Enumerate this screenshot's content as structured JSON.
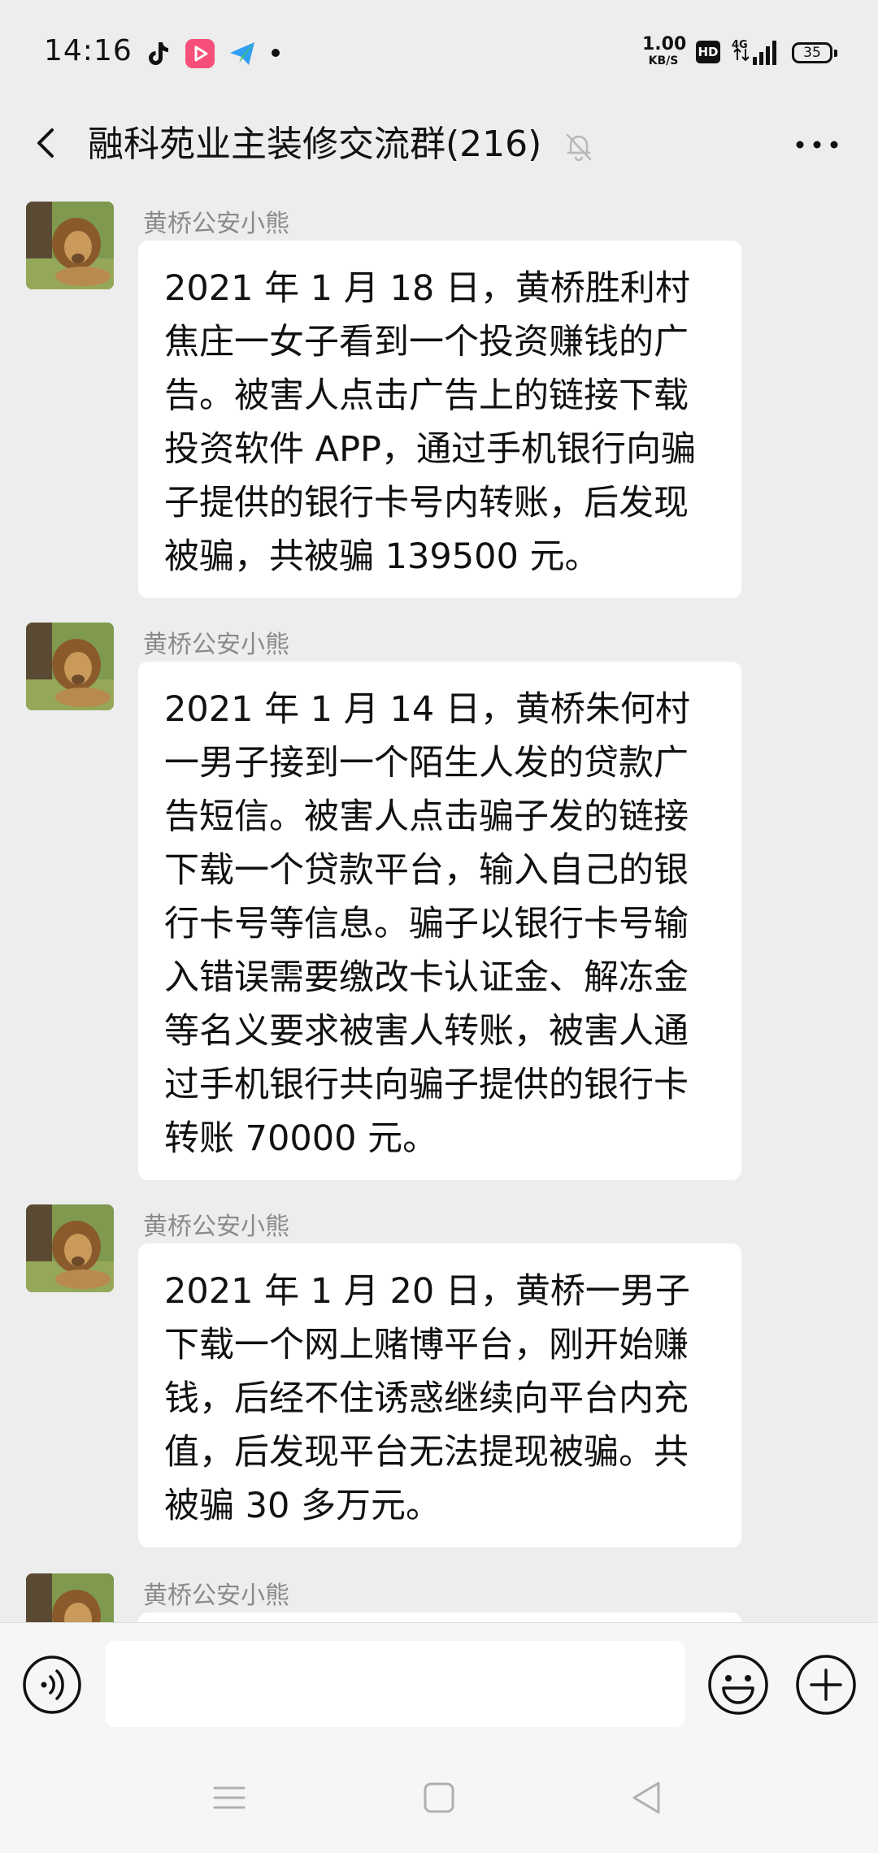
{
  "status_bar": {
    "time": "14:16",
    "app_icons": [
      "tiktok-icon",
      "video-play-icon",
      "paper-plane-icon"
    ],
    "net_speed_value": "1.00",
    "net_speed_unit": "KB/S",
    "hd_label": "HD",
    "network_label": "4G",
    "battery_level": "35"
  },
  "header": {
    "title": "融科苑业主装修交流群(216)",
    "muted": true,
    "back_icon": "chevron-left-icon",
    "mute_icon": "bell-off-icon",
    "more_icon": "more-dots-icon"
  },
  "messages": [
    {
      "sender": "黄桥公安小熊",
      "text": "2021 年 1 月 18 日，黄桥胜利村焦庄一女子看到一个投资赚钱的广告。被害人点击广告上的链接下载投资软件 APP，通过手机银行向骗子提供的银行卡号内转账，后发现被骗，共被骗 139500 元。"
    },
    {
      "sender": "黄桥公安小熊",
      "text": "2021 年 1 月 14 日，黄桥朱何村一男子接到一个陌生人发的贷款广告短信。被害人点击骗子发的链接下载一个贷款平台，输入自己的银行卡号等信息。骗子以银行卡号输入错误需要缴改卡认证金、解冻金等名义要求被害人转账，被害人通过手机银行共向骗子提供的银行卡转账 70000 元。"
    },
    {
      "sender": "黄桥公安小熊",
      "text": "2021 年 1 月 20 日，黄桥一男子下载一个网上赌博平台，刚开始赚钱，后经不住诱惑继续向平台内充值，后发现平台无法提现被骗。共被骗 30 多万元。"
    },
    {
      "sender": "黄桥公安小熊",
      "text": ""
    }
  ],
  "input_bar": {
    "voice_icon": "voice-icon",
    "input_value": "",
    "emoji_icon": "emoji-icon",
    "plus_icon": "plus-icon"
  },
  "nav_bar": {
    "icons": [
      "menu-icon",
      "home-icon",
      "back-triangle-icon"
    ]
  },
  "colors": {
    "background": "#ededed",
    "bubble": "#ffffff",
    "sender_name": "#8a8a8a",
    "text": "#111111"
  }
}
